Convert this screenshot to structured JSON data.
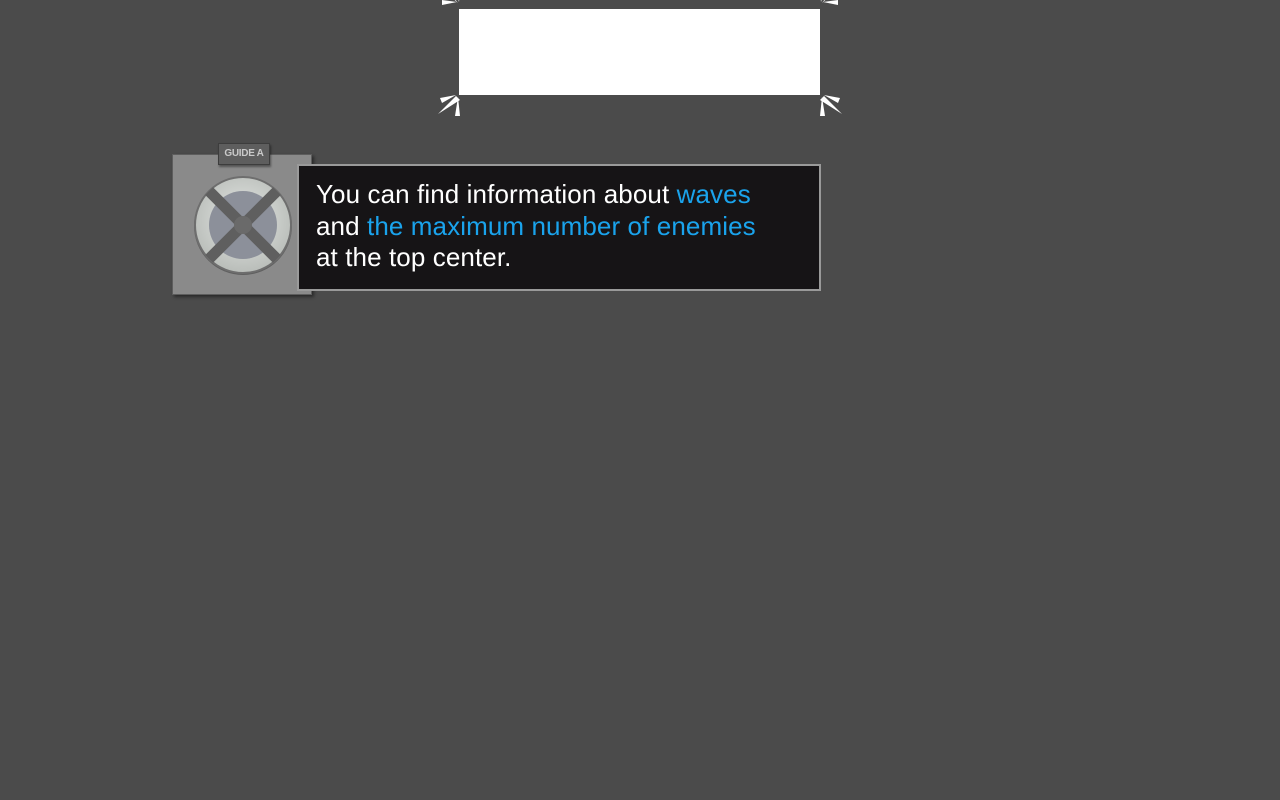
{
  "guide": {
    "tag_label": "GUIDE A",
    "emblem_icon": "crossed-circle-emblem-icon"
  },
  "dialogue": {
    "line1_text": "You can find information about ",
    "line1_highlight": "waves",
    "line2_text": "and ",
    "line2_highlight": "the maximum number of enemies",
    "line3_text": "at the top center."
  },
  "highlight_region": {
    "marker_icon": "corner-burst-icon"
  },
  "colors": {
    "background": "#4b4b4b",
    "highlight_text": "#1aa3ec",
    "dialogue_bg": "#161416",
    "highlight_region": "#ffffff"
  }
}
